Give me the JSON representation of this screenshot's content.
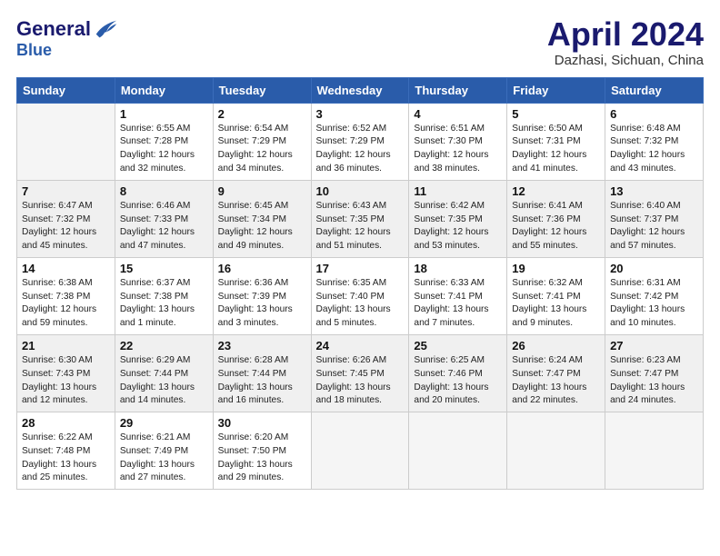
{
  "header": {
    "logo_line1": "General",
    "logo_line2": "Blue",
    "month": "April 2024",
    "location": "Dazhasi, Sichuan, China"
  },
  "weekdays": [
    "Sunday",
    "Monday",
    "Tuesday",
    "Wednesday",
    "Thursday",
    "Friday",
    "Saturday"
  ],
  "weeks": [
    [
      {
        "day": "",
        "sunrise": "",
        "sunset": "",
        "daylight": ""
      },
      {
        "day": "1",
        "sunrise": "Sunrise: 6:55 AM",
        "sunset": "Sunset: 7:28 PM",
        "daylight": "Daylight: 12 hours and 32 minutes."
      },
      {
        "day": "2",
        "sunrise": "Sunrise: 6:54 AM",
        "sunset": "Sunset: 7:29 PM",
        "daylight": "Daylight: 12 hours and 34 minutes."
      },
      {
        "day": "3",
        "sunrise": "Sunrise: 6:52 AM",
        "sunset": "Sunset: 7:29 PM",
        "daylight": "Daylight: 12 hours and 36 minutes."
      },
      {
        "day": "4",
        "sunrise": "Sunrise: 6:51 AM",
        "sunset": "Sunset: 7:30 PM",
        "daylight": "Daylight: 12 hours and 38 minutes."
      },
      {
        "day": "5",
        "sunrise": "Sunrise: 6:50 AM",
        "sunset": "Sunset: 7:31 PM",
        "daylight": "Daylight: 12 hours and 41 minutes."
      },
      {
        "day": "6",
        "sunrise": "Sunrise: 6:48 AM",
        "sunset": "Sunset: 7:32 PM",
        "daylight": "Daylight: 12 hours and 43 minutes."
      }
    ],
    [
      {
        "day": "7",
        "sunrise": "Sunrise: 6:47 AM",
        "sunset": "Sunset: 7:32 PM",
        "daylight": "Daylight: 12 hours and 45 minutes."
      },
      {
        "day": "8",
        "sunrise": "Sunrise: 6:46 AM",
        "sunset": "Sunset: 7:33 PM",
        "daylight": "Daylight: 12 hours and 47 minutes."
      },
      {
        "day": "9",
        "sunrise": "Sunrise: 6:45 AM",
        "sunset": "Sunset: 7:34 PM",
        "daylight": "Daylight: 12 hours and 49 minutes."
      },
      {
        "day": "10",
        "sunrise": "Sunrise: 6:43 AM",
        "sunset": "Sunset: 7:35 PM",
        "daylight": "Daylight: 12 hours and 51 minutes."
      },
      {
        "day": "11",
        "sunrise": "Sunrise: 6:42 AM",
        "sunset": "Sunset: 7:35 PM",
        "daylight": "Daylight: 12 hours and 53 minutes."
      },
      {
        "day": "12",
        "sunrise": "Sunrise: 6:41 AM",
        "sunset": "Sunset: 7:36 PM",
        "daylight": "Daylight: 12 hours and 55 minutes."
      },
      {
        "day": "13",
        "sunrise": "Sunrise: 6:40 AM",
        "sunset": "Sunset: 7:37 PM",
        "daylight": "Daylight: 12 hours and 57 minutes."
      }
    ],
    [
      {
        "day": "14",
        "sunrise": "Sunrise: 6:38 AM",
        "sunset": "Sunset: 7:38 PM",
        "daylight": "Daylight: 12 hours and 59 minutes."
      },
      {
        "day": "15",
        "sunrise": "Sunrise: 6:37 AM",
        "sunset": "Sunset: 7:38 PM",
        "daylight": "Daylight: 13 hours and 1 minute."
      },
      {
        "day": "16",
        "sunrise": "Sunrise: 6:36 AM",
        "sunset": "Sunset: 7:39 PM",
        "daylight": "Daylight: 13 hours and 3 minutes."
      },
      {
        "day": "17",
        "sunrise": "Sunrise: 6:35 AM",
        "sunset": "Sunset: 7:40 PM",
        "daylight": "Daylight: 13 hours and 5 minutes."
      },
      {
        "day": "18",
        "sunrise": "Sunrise: 6:33 AM",
        "sunset": "Sunset: 7:41 PM",
        "daylight": "Daylight: 13 hours and 7 minutes."
      },
      {
        "day": "19",
        "sunrise": "Sunrise: 6:32 AM",
        "sunset": "Sunset: 7:41 PM",
        "daylight": "Daylight: 13 hours and 9 minutes."
      },
      {
        "day": "20",
        "sunrise": "Sunrise: 6:31 AM",
        "sunset": "Sunset: 7:42 PM",
        "daylight": "Daylight: 13 hours and 10 minutes."
      }
    ],
    [
      {
        "day": "21",
        "sunrise": "Sunrise: 6:30 AM",
        "sunset": "Sunset: 7:43 PM",
        "daylight": "Daylight: 13 hours and 12 minutes."
      },
      {
        "day": "22",
        "sunrise": "Sunrise: 6:29 AM",
        "sunset": "Sunset: 7:44 PM",
        "daylight": "Daylight: 13 hours and 14 minutes."
      },
      {
        "day": "23",
        "sunrise": "Sunrise: 6:28 AM",
        "sunset": "Sunset: 7:44 PM",
        "daylight": "Daylight: 13 hours and 16 minutes."
      },
      {
        "day": "24",
        "sunrise": "Sunrise: 6:26 AM",
        "sunset": "Sunset: 7:45 PM",
        "daylight": "Daylight: 13 hours and 18 minutes."
      },
      {
        "day": "25",
        "sunrise": "Sunrise: 6:25 AM",
        "sunset": "Sunset: 7:46 PM",
        "daylight": "Daylight: 13 hours and 20 minutes."
      },
      {
        "day": "26",
        "sunrise": "Sunrise: 6:24 AM",
        "sunset": "Sunset: 7:47 PM",
        "daylight": "Daylight: 13 hours and 22 minutes."
      },
      {
        "day": "27",
        "sunrise": "Sunrise: 6:23 AM",
        "sunset": "Sunset: 7:47 PM",
        "daylight": "Daylight: 13 hours and 24 minutes."
      }
    ],
    [
      {
        "day": "28",
        "sunrise": "Sunrise: 6:22 AM",
        "sunset": "Sunset: 7:48 PM",
        "daylight": "Daylight: 13 hours and 25 minutes."
      },
      {
        "day": "29",
        "sunrise": "Sunrise: 6:21 AM",
        "sunset": "Sunset: 7:49 PM",
        "daylight": "Daylight: 13 hours and 27 minutes."
      },
      {
        "day": "30",
        "sunrise": "Sunrise: 6:20 AM",
        "sunset": "Sunset: 7:50 PM",
        "daylight": "Daylight: 13 hours and 29 minutes."
      },
      {
        "day": "",
        "sunrise": "",
        "sunset": "",
        "daylight": ""
      },
      {
        "day": "",
        "sunrise": "",
        "sunset": "",
        "daylight": ""
      },
      {
        "day": "",
        "sunrise": "",
        "sunset": "",
        "daylight": ""
      },
      {
        "day": "",
        "sunrise": "",
        "sunset": "",
        "daylight": ""
      }
    ]
  ]
}
